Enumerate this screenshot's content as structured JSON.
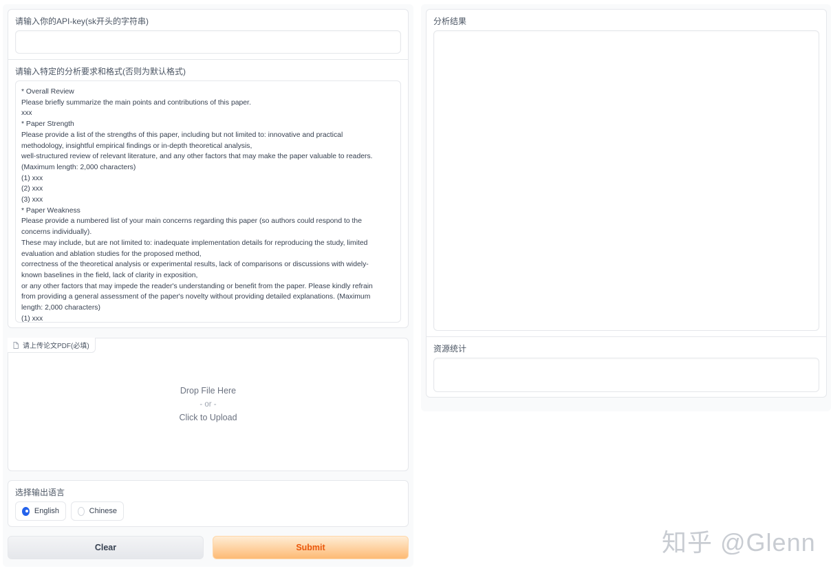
{
  "left": {
    "api_key": {
      "label": "请输入你的API-key(sk开头的字符串)",
      "value": "",
      "placeholder": ""
    },
    "requirements": {
      "label": "请输入特定的分析要求和格式(否则为默认格式)",
      "lines": [
        "* Overall Review",
        "Please briefly summarize the main points and contributions of this paper.",
        "xxx",
        "* Paper Strength",
        "Please provide a list of the strengths of this paper, including but not limited to: innovative and practical",
        "methodology, insightful empirical findings or in-depth theoretical analysis,",
        "well-structured review of relevant literature, and any other factors that may make the paper valuable to readers.",
        "(Maximum length: 2,000 characters)",
        "(1) xxx",
        "(2) xxx",
        "(3) xxx",
        "* Paper Weakness",
        "Please provide a numbered list of your main concerns regarding this paper (so authors could respond to the",
        "concerns individually).",
        "These may include, but are not limited to: inadequate implementation details for reproducing the study, limited",
        "evaluation and ablation studies for the proposed method,",
        "correctness of the theoretical analysis or experimental results, lack of comparisons or discussions with widely-",
        "known baselines in the field, lack of clarity in exposition,",
        "or any other factors that may impede the reader's understanding or benefit from the paper. Please kindly refrain",
        "from providing a general assessment of the paper's novelty without providing detailed explanations. (Maximum",
        "length: 2,000 characters)",
        "(1) xxx"
      ]
    },
    "upload": {
      "tab_label": "请上传论文PDF(必填)",
      "icon": "file-icon",
      "drop_text": "Drop File Here",
      "or_text": "- or -",
      "click_text": "Click to Upload"
    },
    "language": {
      "label": "选择输出语言",
      "options": [
        "English",
        "Chinese"
      ],
      "selected": "English"
    },
    "buttons": {
      "clear": "Clear",
      "submit": "Submit"
    }
  },
  "right": {
    "result": {
      "label": "分析结果",
      "value": ""
    },
    "stats": {
      "label": "资源统计",
      "value": ""
    }
  },
  "watermark": "知乎 @Glenn",
  "colors": {
    "accent": "#2563eb",
    "submit_text": "#ea580c",
    "submit_bg_top": "#ffedd5",
    "submit_bg_bottom": "#fdba74",
    "border": "#e5e7eb"
  }
}
